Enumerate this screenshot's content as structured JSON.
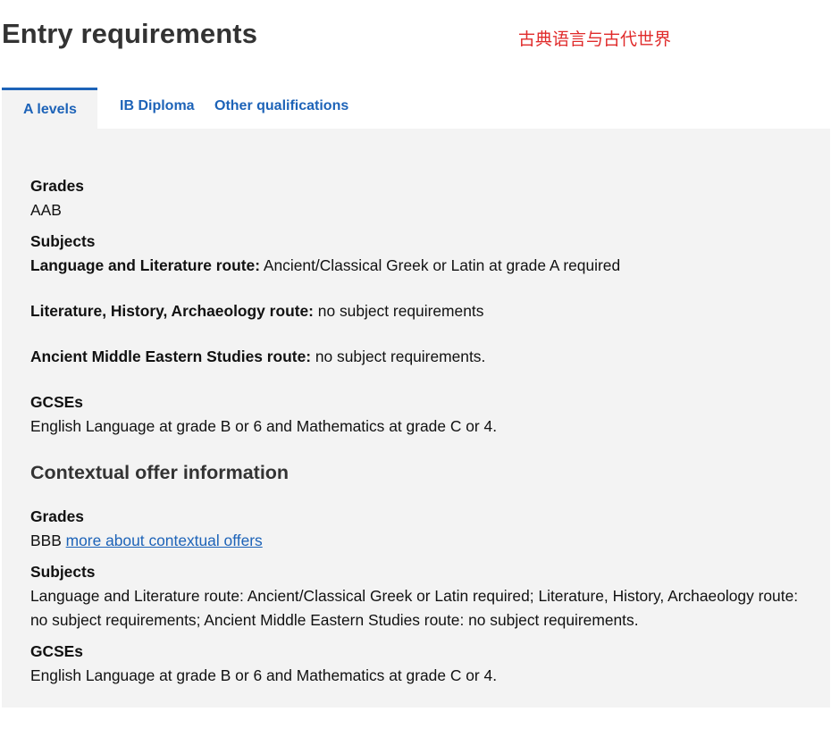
{
  "page": {
    "title": "Entry requirements",
    "annotation": "古典语言与古代世界"
  },
  "tabs": [
    {
      "label": "A levels",
      "active": true
    },
    {
      "label": "IB Diploma",
      "active": false
    },
    {
      "label": "Other qualifications",
      "active": false
    }
  ],
  "alevels": {
    "grades_label": "Grades",
    "grades_value": "AAB",
    "subjects_label": "Subjects",
    "routes": [
      {
        "label": "Language and Literature route:",
        "text": " Ancient/Classical Greek or Latin at grade A required"
      },
      {
        "label": "Literature, History, Archaeology route:",
        "text": " no subject requirements"
      },
      {
        "label": "Ancient Middle Eastern Studies route:",
        "text": " no subject requirements."
      }
    ],
    "gcse_label": "GCSEs",
    "gcse_value": "English Language at grade B or 6 and Mathematics at grade C or 4."
  },
  "contextual": {
    "heading": "Contextual offer information",
    "grades_label": "Grades",
    "grades_value": "BBB ",
    "grades_link": "more about contextual offers",
    "subjects_label": "Subjects",
    "subjects_value": "Language and Literature route: Ancient/Classical Greek or Latin required; Literature, History, Archaeology route: no subject requirements; Ancient Middle Eastern Studies route: no subject requirements.",
    "gcse_label": "GCSEs",
    "gcse_value": "English Language at grade B or 6 and Mathematics at grade C or 4."
  },
  "colors": {
    "accent": "#1d63b8",
    "panel_bg": "#f3f3f3",
    "annotation": "#e02b2b",
    "heading": "#333333"
  }
}
